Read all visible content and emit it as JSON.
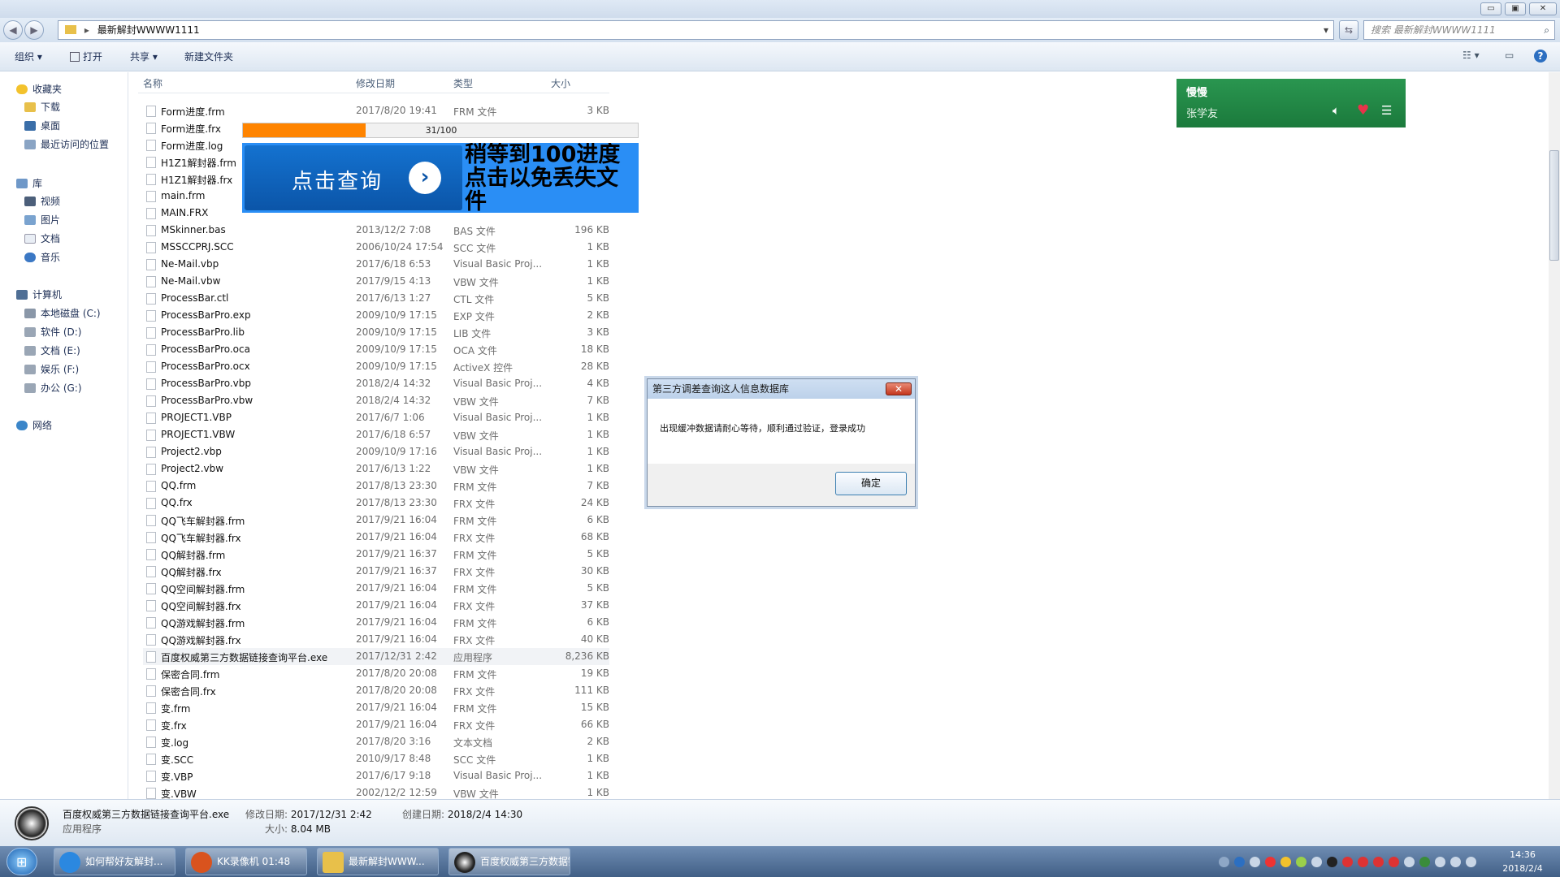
{
  "window": {
    "min": "▭",
    "max": "▣",
    "close": "✕"
  },
  "address": {
    "path": "最新解封WWWW1111",
    "search_placeholder": "搜索 最新解封WWWW1111"
  },
  "toolbar": {
    "organize": "组织",
    "open": "打开",
    "share": "共享",
    "new_folder": "新建文件夹"
  },
  "sidebar": {
    "favorites": "收藏夹",
    "downloads": "下载",
    "desktop": "桌面",
    "recent": "最近访问的位置",
    "libraries": "库",
    "videos": "视频",
    "pictures": "图片",
    "documents": "文档",
    "music": "音乐",
    "computer": "计算机",
    "drives": [
      "本地磁盘 (C:)",
      "软件 (D:)",
      "文档 (E:)",
      "娱乐 (F:)",
      "办公 (G:)"
    ],
    "network": "网络"
  },
  "columns": {
    "name": "名称",
    "date": "修改日期",
    "type": "类型",
    "size": "大小"
  },
  "files": [
    [
      "Form进度.frm",
      "2017/8/20 19:41",
      "FRM 文件",
      "3 KB"
    ],
    [
      "Form进度.frx",
      "",
      "",
      ""
    ],
    [
      "Form进度.log",
      "",
      "",
      ""
    ],
    [
      "H1Z1解封器.frm",
      "",
      "",
      ""
    ],
    [
      "H1Z1解封器.frx",
      "",
      "",
      ""
    ],
    [
      "main.frm",
      "",
      "",
      ""
    ],
    [
      "MAIN.FRX",
      "",
      "",
      ""
    ],
    [
      "MSkinner.bas",
      "2013/12/2 7:08",
      "BAS 文件",
      "196 KB"
    ],
    [
      "MSSCCPRJ.SCC",
      "2006/10/24 17:54",
      "SCC 文件",
      "1 KB"
    ],
    [
      "Ne-Mail.vbp",
      "2017/6/18 6:53",
      "Visual Basic Proj...",
      "1 KB"
    ],
    [
      "Ne-Mail.vbw",
      "2017/9/15 4:13",
      "VBW 文件",
      "1 KB"
    ],
    [
      "ProcessBar.ctl",
      "2017/6/13 1:27",
      "CTL 文件",
      "5 KB"
    ],
    [
      "ProcessBarPro.exp",
      "2009/10/9 17:15",
      "EXP 文件",
      "2 KB"
    ],
    [
      "ProcessBarPro.lib",
      "2009/10/9 17:15",
      "LIB 文件",
      "3 KB"
    ],
    [
      "ProcessBarPro.oca",
      "2009/10/9 17:15",
      "OCA 文件",
      "18 KB"
    ],
    [
      "ProcessBarPro.ocx",
      "2009/10/9 17:15",
      "ActiveX 控件",
      "28 KB"
    ],
    [
      "ProcessBarPro.vbp",
      "2018/2/4 14:32",
      "Visual Basic Proj...",
      "4 KB"
    ],
    [
      "ProcessBarPro.vbw",
      "2018/2/4 14:32",
      "VBW 文件",
      "7 KB"
    ],
    [
      "PROJECT1.VBP",
      "2017/6/7 1:06",
      "Visual Basic Proj...",
      "1 KB"
    ],
    [
      "PROJECT1.VBW",
      "2017/6/18 6:57",
      "VBW 文件",
      "1 KB"
    ],
    [
      "Project2.vbp",
      "2009/10/9 17:16",
      "Visual Basic Proj...",
      "1 KB"
    ],
    [
      "Project2.vbw",
      "2017/6/13 1:22",
      "VBW 文件",
      "1 KB"
    ],
    [
      "QQ.frm",
      "2017/8/13 23:30",
      "FRM 文件",
      "7 KB"
    ],
    [
      "QQ.frx",
      "2017/8/13 23:30",
      "FRX 文件",
      "24 KB"
    ],
    [
      "QQ飞车解封器.frm",
      "2017/9/21 16:04",
      "FRM 文件",
      "6 KB"
    ],
    [
      "QQ飞车解封器.frx",
      "2017/9/21 16:04",
      "FRX 文件",
      "68 KB"
    ],
    [
      "QQ解封器.frm",
      "2017/9/21 16:37",
      "FRM 文件",
      "5 KB"
    ],
    [
      "QQ解封器.frx",
      "2017/9/21 16:37",
      "FRX 文件",
      "30 KB"
    ],
    [
      "QQ空间解封器.frm",
      "2017/9/21 16:04",
      "FRM 文件",
      "5 KB"
    ],
    [
      "QQ空间解封器.frx",
      "2017/9/21 16:04",
      "FRX 文件",
      "37 KB"
    ],
    [
      "QQ游戏解封器.frm",
      "2017/9/21 16:04",
      "FRM 文件",
      "6 KB"
    ],
    [
      "QQ游戏解封器.frx",
      "2017/9/21 16:04",
      "FRX 文件",
      "40 KB"
    ],
    [
      "百度权威第三方数据链接查询平台.exe",
      "2017/12/31 2:42",
      "应用程序",
      "8,236 KB"
    ],
    [
      "保密合同.frm",
      "2017/8/20 20:08",
      "FRM 文件",
      "19 KB"
    ],
    [
      "保密合同.frx",
      "2017/8/20 20:08",
      "FRX 文件",
      "111 KB"
    ],
    [
      "变.frm",
      "2017/9/21 16:04",
      "FRM 文件",
      "15 KB"
    ],
    [
      "变.frx",
      "2017/9/21 16:04",
      "FRX 文件",
      "66 KB"
    ],
    [
      "变.log",
      "2017/8/20 3:16",
      "文本文档",
      "2 KB"
    ],
    [
      "变.SCC",
      "2010/9/17 8:48",
      "SCC 文件",
      "1 KB"
    ],
    [
      "变.VBP",
      "2017/6/17 9:18",
      "Visual Basic Proj...",
      "1 KB"
    ],
    [
      "变.VBW",
      "2002/12/2 12:59",
      "VBW 文件",
      "1 KB"
    ]
  ],
  "selected_index": 32,
  "progress": {
    "label": "31/100",
    "fraction": 0.31
  },
  "banner": {
    "button": "点击查询",
    "message": "稍等到100进度点击以免丢失文件"
  },
  "music": {
    "title": "慢慢",
    "artist": "张学友"
  },
  "dialog": {
    "title": "第三方调差查询这人信息数据库",
    "message": "出现缓冲数据请耐心等待，顺利通过验证，登录成功",
    "ok": "确定"
  },
  "details": {
    "name": "百度权威第三方数据链接查询平台.exe",
    "kind": "应用程序",
    "modified_label": "修改日期:",
    "modified": "2017/12/31 2:42",
    "size_label": "大小:",
    "size": "8.04 MB",
    "created_label": "创建日期:",
    "created": "2018/2/4 14:30"
  },
  "taskbar": {
    "tasks": [
      "如何帮好友解封...",
      "KK录像机 01:48",
      "最新解封WWW...",
      "百度权威第三方数据链接查询平台"
    ],
    "time": "14:36",
    "date": "2018/2/4"
  },
  "colors": {
    "accent": "#ff8400",
    "banner": "#2a8ef5",
    "music": "#1b7a3c",
    "heart": "#e8334a"
  }
}
